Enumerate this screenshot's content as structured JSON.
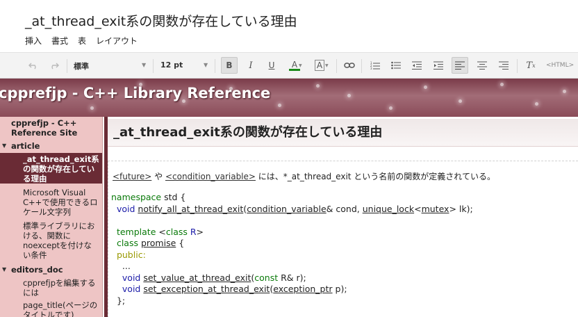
{
  "doc": {
    "title": "_at_thread_exit系の関数が存在している理由"
  },
  "menu": {
    "insert": "挿入",
    "format": "書式",
    "table": "表",
    "layout": "レイアウト"
  },
  "toolbar": {
    "style_value": "標準",
    "size_value": "12 pt",
    "html_label": "<HTML>",
    "text_color_hex": "#1a8a1a"
  },
  "banner": {
    "title": "cpprefjp - C++ Library Reference"
  },
  "sidebar": {
    "site": "cpprefjp - C++ Reference Site",
    "article": "article",
    "active": "_at_thread_exit系の関数が存在している理由",
    "item_msvc": "Microsoft Visual C++で使用できるロケール文字列",
    "item_noexcept": "標準ライブラリにおける、関数にnoexceptを付けない条件",
    "editors_doc": "editors_doc",
    "item_edit": "cpprefjpを編集するには",
    "item_page_title": "page_title(ページのタイトルです)"
  },
  "main": {
    "heading": "_at_thread_exit系の関数が存在している理由",
    "intro": {
      "link1": "<future>",
      "mid1": " や ",
      "link2": "<condition_variable>",
      "rest": " には、*_at_thread_exit という名前の関数が定義されている。"
    }
  }
}
